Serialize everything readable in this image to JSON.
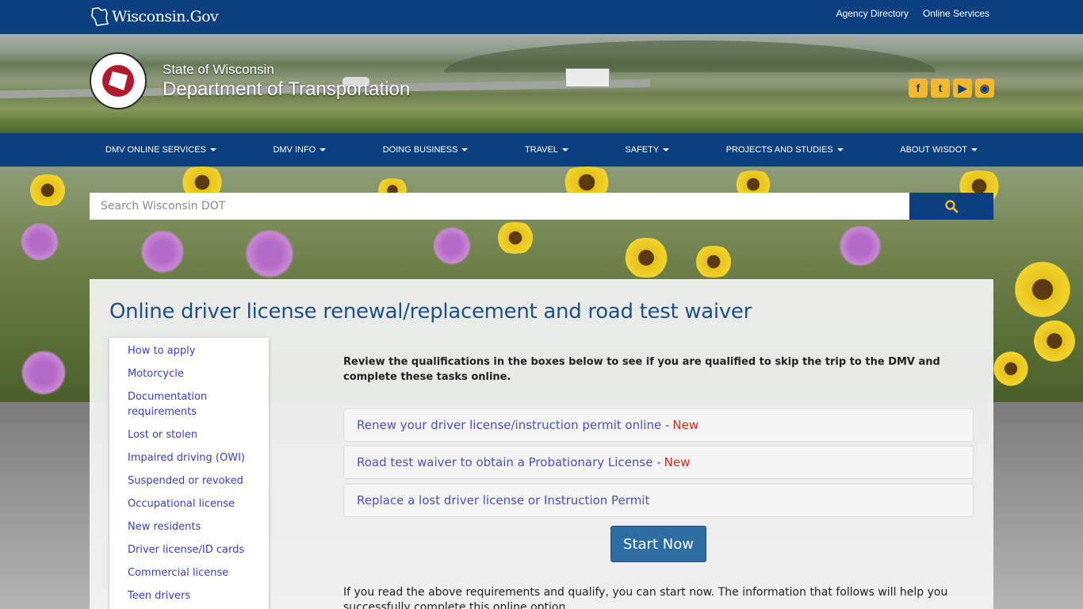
{
  "brand": {
    "wisconsin_gov": "Wisconsin.Gov",
    "site_sub": "State of Wisconsin",
    "site_title": "Department of Transportation"
  },
  "top_links": [
    "Agency Directory",
    "Online Services"
  ],
  "social_icons": [
    "facebook-icon",
    "twitter-icon",
    "youtube-icon",
    "podcast-icon"
  ],
  "nav": [
    "DMV ONLINE SERVICES",
    "DMV INFO",
    "DOING BUSINESS",
    "TRAVEL",
    "SAFETY",
    "PROJECTS AND STUDIES",
    "ABOUT WISDOT"
  ],
  "search": {
    "placeholder": "Search Wisconsin DOT",
    "button_icon": "search-icon"
  },
  "page": {
    "title": "Online driver license renewal/replacement and road test waiver",
    "intro": "Review the qualifications in the boxes below to see if you are qualified to skip the trip to the DMV and complete these tasks online.",
    "accordions": [
      {
        "label": "Renew your driver license/instruction permit online - ",
        "badge": "New"
      },
      {
        "label": "Road test waiver to obtain a Probationary License - ",
        "badge": "New"
      },
      {
        "label": "Replace a lost driver license or Instruction Permit",
        "badge": ""
      }
    ],
    "start_label": "Start Now",
    "outro": "If you read the above requirements and qualify, you can start now. The information that follows will help you successfully complete this online option."
  },
  "sidenav": [
    "How to apply",
    "Motorcycle",
    "Documentation requirements",
    "Lost or stolen",
    "Impaired driving (OWI)",
    "Suspended or revoked",
    "Occupational license",
    "New residents",
    "Driver license/ID cards",
    "Commercial license",
    "Teen drivers"
  ],
  "colors": {
    "brand_blue": "#0b3f7e",
    "link_blue": "#3b3fc8",
    "new_red": "#d9271a",
    "accent_yellow": "#f4b82a"
  }
}
